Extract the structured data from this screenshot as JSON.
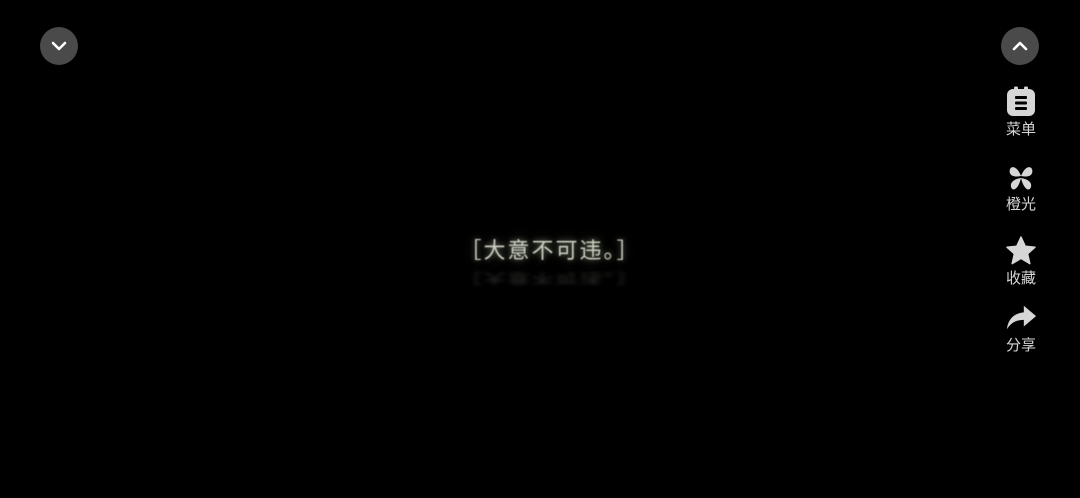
{
  "top_controls": {
    "collapse_icon": "chevron-down-icon",
    "expand_icon": "chevron-up-icon"
  },
  "side_menu": {
    "items": [
      {
        "label": "菜单",
        "icon": "menu-icon"
      },
      {
        "label": "橙光",
        "icon": "orange-light-logo-icon"
      },
      {
        "label": "收藏",
        "icon": "star-icon"
      },
      {
        "label": "分享",
        "icon": "share-arrow-icon"
      }
    ]
  },
  "scene": {
    "dialogue_text": "［大意不可违。］"
  },
  "colors": {
    "background": "#000000",
    "button_bg": "#4a4a4a",
    "icon_color": "#d6d6d6"
  }
}
